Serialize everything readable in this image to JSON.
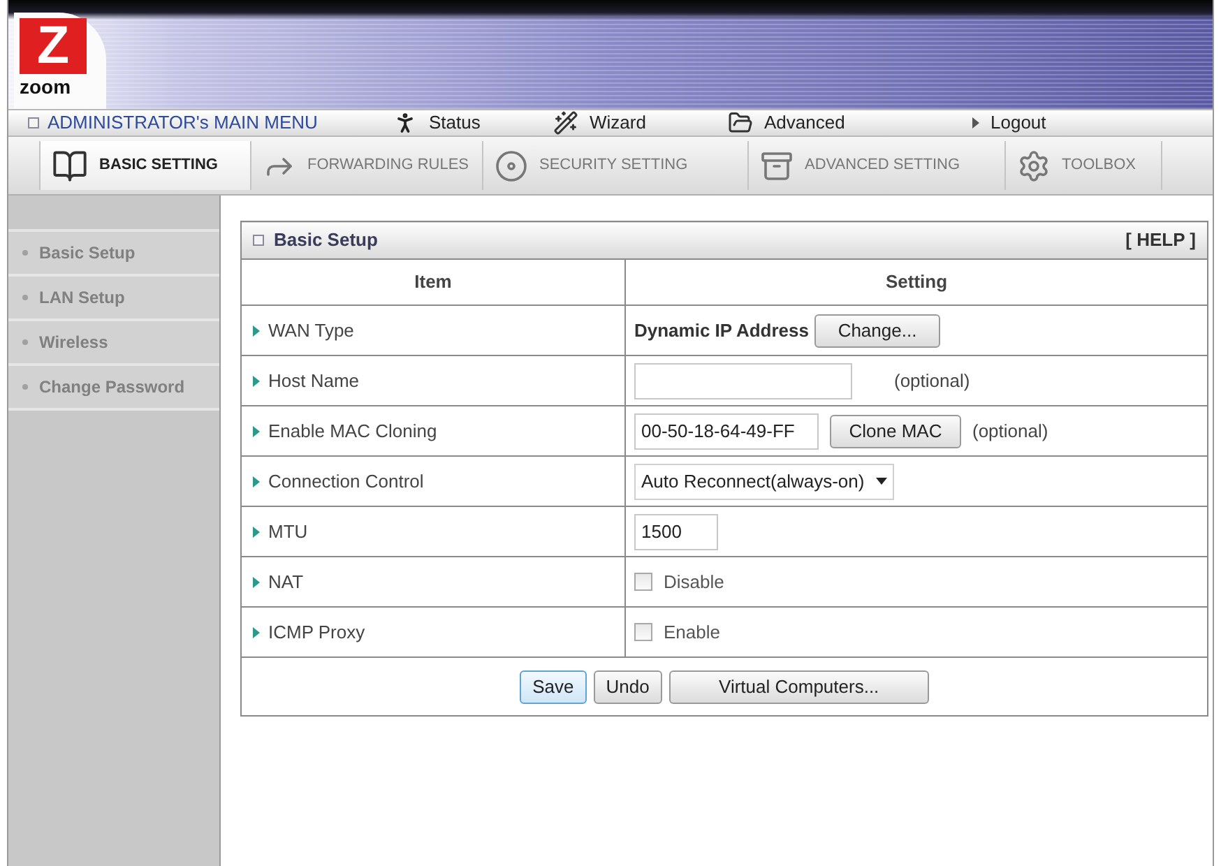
{
  "logo": {
    "mark": "Z",
    "wordmark": "zoom"
  },
  "main_menu": {
    "title": "ADMINISTRATOR's MAIN MENU",
    "items": [
      {
        "kind": "status",
        "label": "Status"
      },
      {
        "kind": "wizard",
        "label": "Wizard"
      },
      {
        "kind": "advanced",
        "label": "Advanced"
      },
      {
        "kind": "logout",
        "label": "Logout"
      }
    ]
  },
  "tabs": [
    {
      "kind": "basic",
      "label": "BASIC SETTING",
      "selected": true
    },
    {
      "kind": "forwarding",
      "label": "FORWARDING RULES",
      "selected": false
    },
    {
      "kind": "security",
      "label": "SECURITY SETTING",
      "selected": false
    },
    {
      "kind": "advanced",
      "label": "ADVANCED SETTING",
      "selected": false
    },
    {
      "kind": "toolbox",
      "label": "TOOLBOX",
      "selected": false
    }
  ],
  "sidebar": {
    "items": [
      {
        "label": "Basic Setup"
      },
      {
        "label": "LAN Setup"
      },
      {
        "label": "Wireless"
      },
      {
        "label": "Change Password"
      }
    ]
  },
  "panel": {
    "title": "Basic Setup",
    "help": "[ HELP ]",
    "columns": [
      "Item",
      "Setting"
    ],
    "rows": [
      {
        "kind": "text",
        "item": "WAN Type",
        "value": "Dynamic IP Address",
        "button": "Change..."
      },
      {
        "kind": "input",
        "item": "Host Name",
        "note": "(optional)"
      },
      {
        "kind": "input",
        "item": "Enable MAC Cloning",
        "value": "00-50-18-64-49-FF",
        "button": "Clone MAC",
        "note": "(optional)"
      },
      {
        "kind": "select",
        "item": "Connection Control",
        "value": "Auto Reconnect(always-on)"
      },
      {
        "kind": "input",
        "item": "MTU",
        "value": "1500"
      },
      {
        "kind": "checkbox",
        "item": "NAT",
        "label": "Disable",
        "checked": false
      },
      {
        "kind": "checkbox",
        "item": "ICMP Proxy",
        "label": "Enable",
        "checked": false
      }
    ],
    "buttons": [
      {
        "label": "Save",
        "focused": true
      },
      {
        "label": "Undo",
        "focused": false
      },
      {
        "label": "Virtual Computers...",
        "focused": false
      }
    ]
  }
}
